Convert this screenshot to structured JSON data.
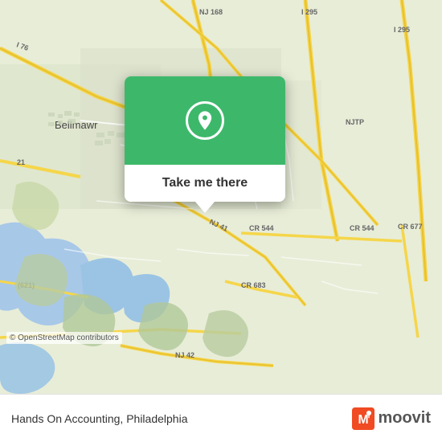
{
  "map": {
    "background_color": "#e8f0d8",
    "copyright": "© OpenStreetMap contributors"
  },
  "popup": {
    "take_me_there_label": "Take me there",
    "pin_color": "#3db86b"
  },
  "bottom_bar": {
    "place_name": "Hands On Accounting, Philadelphia",
    "moovit_label": "moovit",
    "separator": ","
  }
}
